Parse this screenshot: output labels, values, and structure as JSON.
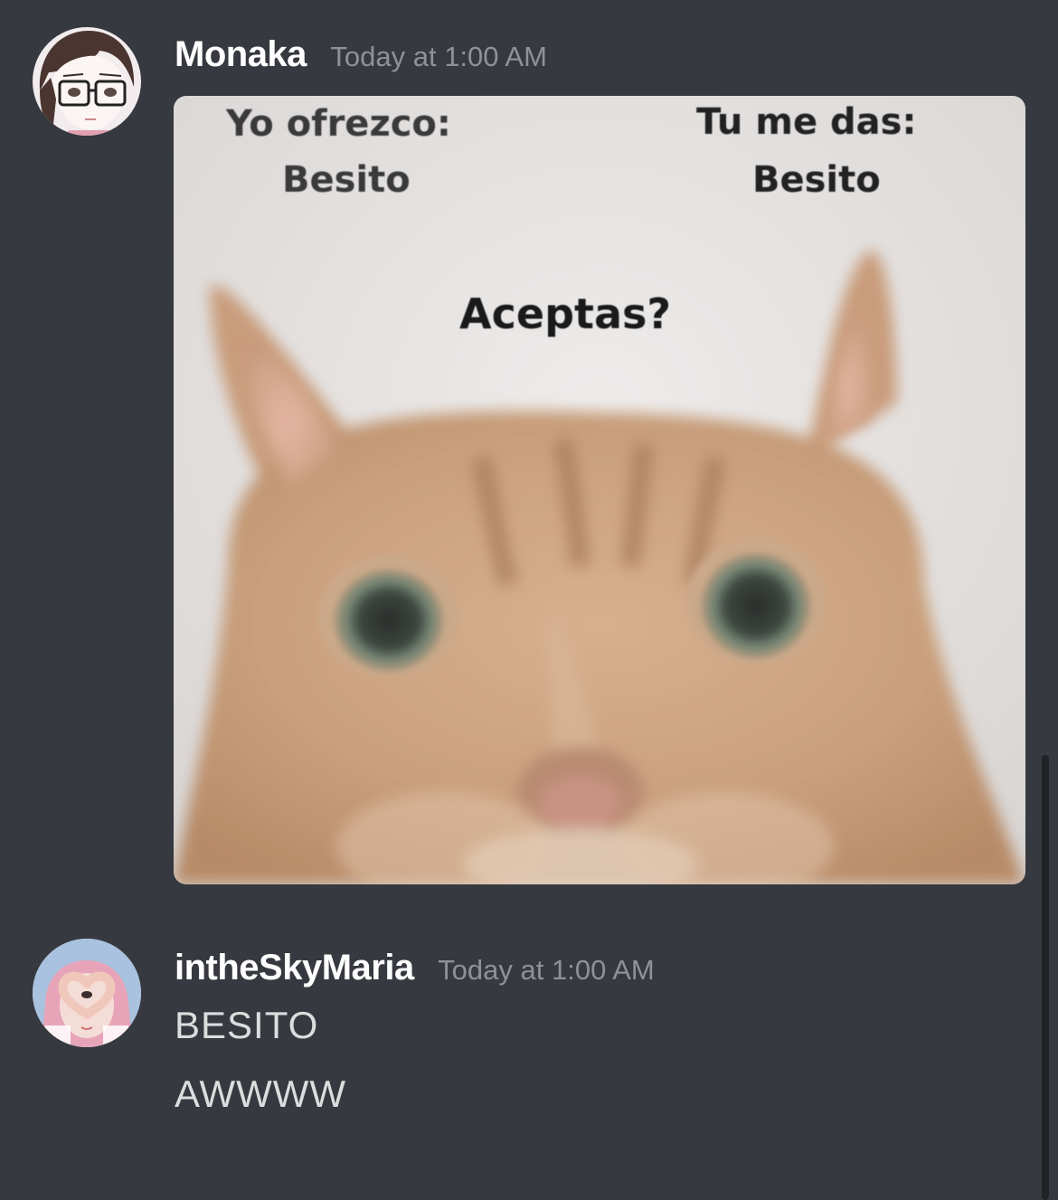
{
  "messages": [
    {
      "username": "Monaka",
      "timestamp": "Today at 1:00 AM",
      "avatar_icon": "anime-glasses-avatar",
      "attachment": {
        "type": "image",
        "meme_text": {
          "offer_label": "Yo ofrezco:",
          "offer_value": "Besito",
          "give_label": "Tu me das:",
          "give_value": "Besito",
          "question": "Aceptas?"
        }
      }
    },
    {
      "username": "intheSkyMaria",
      "timestamp": "Today at 1:00 AM",
      "avatar_icon": "pink-hair-heart-hands-avatar",
      "lines": [
        "BESITO",
        "AWWWW"
      ]
    }
  ],
  "colors": {
    "background": "#36393f",
    "username": "#ffffff",
    "timestamp": "#8e9297",
    "message_text": "#dcddde"
  }
}
